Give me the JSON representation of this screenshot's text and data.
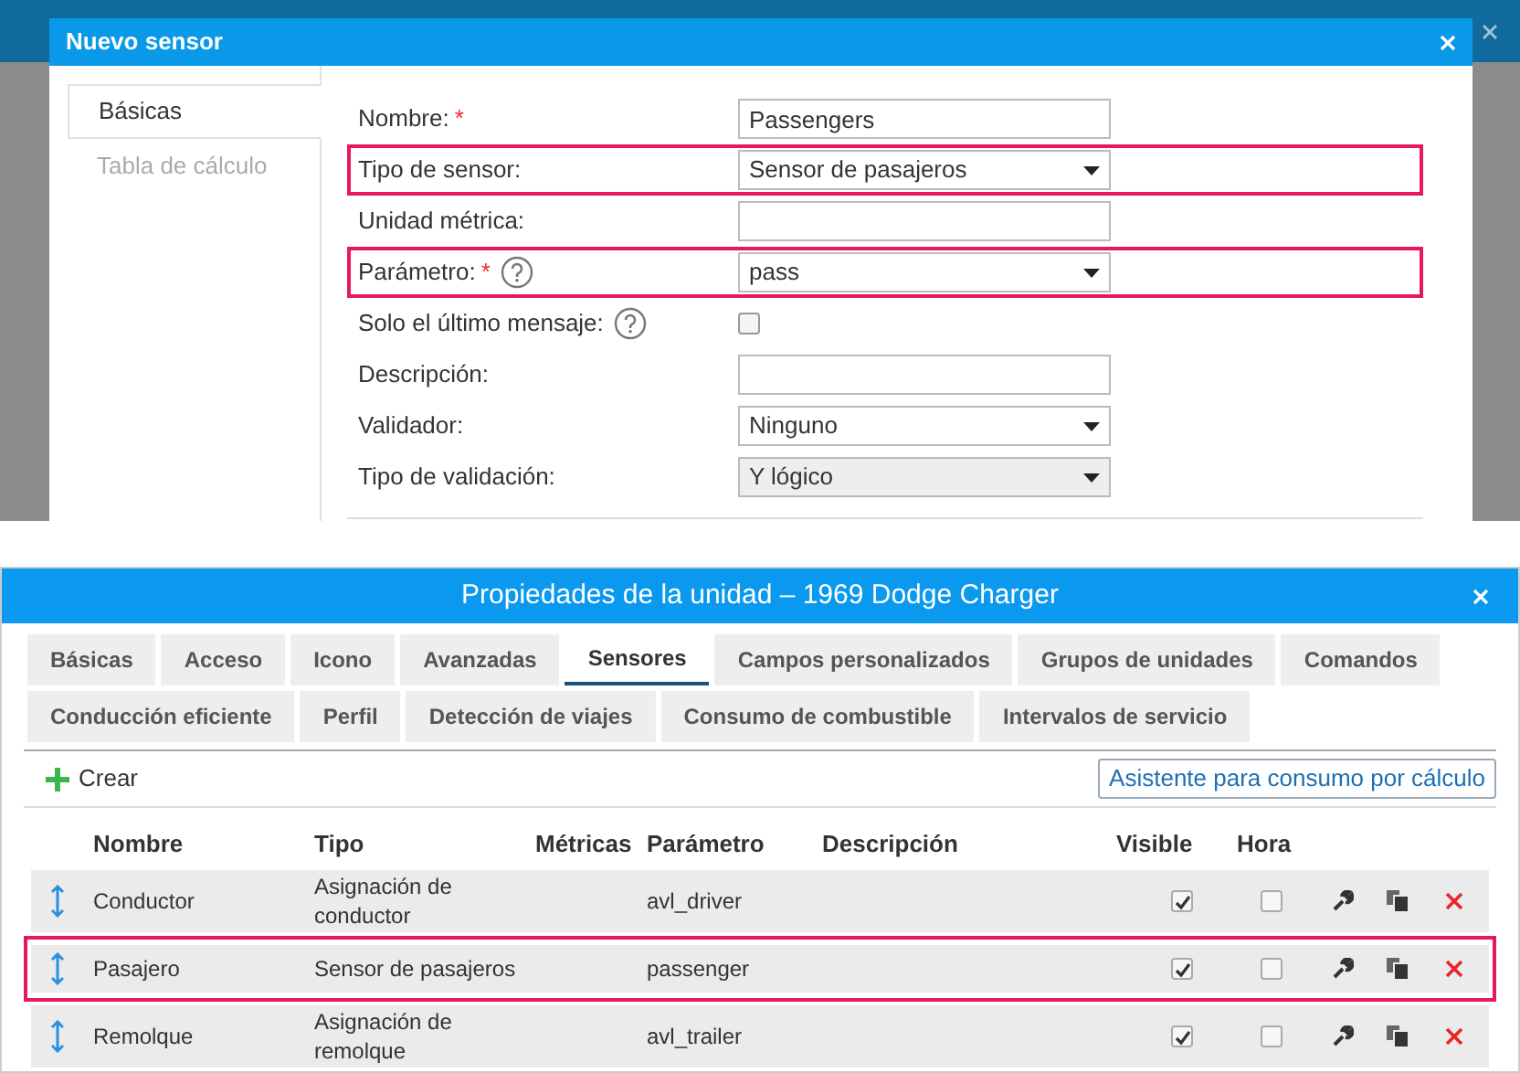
{
  "dialog": {
    "title": "Nuevo sensor",
    "tabs": [
      {
        "label": "Básicas",
        "selected": true
      },
      {
        "label": "Tabla de cálculo",
        "selected": false
      }
    ],
    "fields": [
      {
        "kind": "text",
        "label": "Nombre:",
        "required_mark": "*",
        "help": false,
        "value": "Passengers",
        "highlighted": false,
        "disabled": false
      },
      {
        "kind": "select",
        "label": "Tipo de sensor:",
        "help": false,
        "value": "Sensor de pasajeros",
        "highlighted": true,
        "disabled": false
      },
      {
        "kind": "text",
        "label": "Unidad métrica:",
        "help": false,
        "highlighted": false,
        "disabled": false
      },
      {
        "kind": "select",
        "label": "Parámetro:",
        "required_mark": "*",
        "help": true,
        "value": "pass",
        "highlighted": true,
        "disabled": false
      },
      {
        "kind": "checkbox",
        "label": "Solo el último mensaje:",
        "help": true,
        "checked": false,
        "highlighted": false,
        "disabled": false
      },
      {
        "kind": "text",
        "label": "Descripción:",
        "help": false,
        "highlighted": false,
        "disabled": false
      },
      {
        "kind": "select",
        "label": "Validador:",
        "help": false,
        "value": "Ninguno",
        "highlighted": false,
        "disabled": false
      },
      {
        "kind": "select",
        "label": "Tipo de validación:",
        "help": false,
        "value": "Y lógico",
        "highlighted": false,
        "disabled": true
      }
    ]
  },
  "unit_window": {
    "title": "Propiedades de la unidad – 1969 Dodge Charger",
    "tab_rows": [
      [
        {
          "label": "Básicas",
          "selected": false
        },
        {
          "label": "Acceso",
          "selected": false
        },
        {
          "label": "Icono",
          "selected": false
        },
        {
          "label": "Avanzadas",
          "selected": false
        },
        {
          "label": "Sensores",
          "selected": true
        },
        {
          "label": "Campos personalizados",
          "selected": false
        },
        {
          "label": "Grupos de unidades",
          "selected": false
        },
        {
          "label": "Comandos",
          "selected": false
        }
      ],
      [
        {
          "label": "Conducción eficiente",
          "selected": false
        },
        {
          "label": "Perfil",
          "selected": false
        },
        {
          "label": "Detección de viajes",
          "selected": false
        },
        {
          "label": "Consumo de combustible",
          "selected": false
        },
        {
          "label": "Intervalos de servicio",
          "selected": false
        }
      ]
    ],
    "create_button": "Crear",
    "wizard_button": "Asistente para consumo por cálculo",
    "table": {
      "columns": [
        "Nombre",
        "Tipo",
        "Métricas",
        "Parámetro",
        "Descripción",
        "Visible",
        "Hora"
      ],
      "rows": [
        {
          "name": "Conductor",
          "type": "Asignación de conductor",
          "parameter": "avl_driver",
          "visible": true,
          "time": false,
          "highlighted": false
        },
        {
          "name": "Pasajero",
          "type": "Sensor de pasajeros",
          "parameter": "passenger",
          "visible": true,
          "time": false,
          "highlighted": true
        },
        {
          "name": "Remolque",
          "type": "Asignación de remolque",
          "parameter": "avl_trailer",
          "visible": true,
          "time": false,
          "highlighted": false
        }
      ]
    }
  }
}
